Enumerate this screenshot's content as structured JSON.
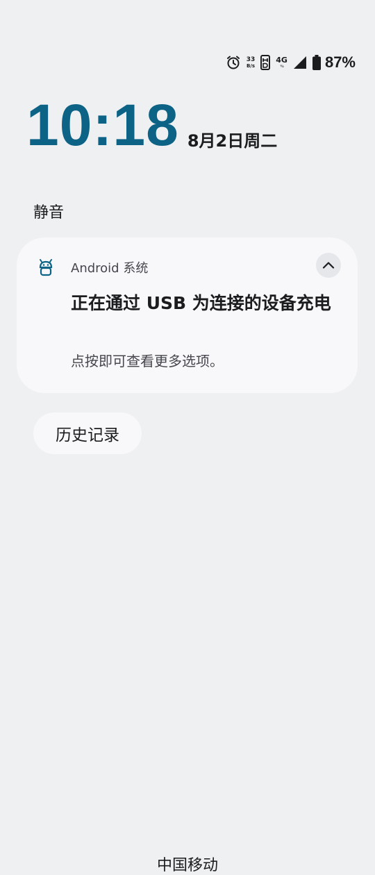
{
  "status_bar": {
    "alarm_icon": "alarm-clock-icon",
    "net_speed_value": "33",
    "net_speed_unit": "B/s",
    "volte_icon": "hd-icon",
    "net_type": "4G",
    "net_arrows": "▾▴",
    "signal_icon": "signal-bars-icon",
    "battery_icon": "battery-icon",
    "battery_percent": "87%"
  },
  "lockscreen": {
    "time": "10:18",
    "date": "8月2日周二",
    "section_label": "静音"
  },
  "notification": {
    "app_icon": "android-robot-icon",
    "app_name": "Android 系统",
    "expand_icon": "chevron-up-icon",
    "title": "正在通过 USB 为连接的设备充电",
    "body": "点按即可查看更多选项。"
  },
  "history_button": {
    "label": "历史记录"
  },
  "carrier": "中国移动",
  "colors": {
    "background": "#eff0f2",
    "card": "#f8f8fa",
    "clock_accent": "#0d6386",
    "text_primary": "#1b1c1e",
    "text_secondary": "#45474c"
  }
}
